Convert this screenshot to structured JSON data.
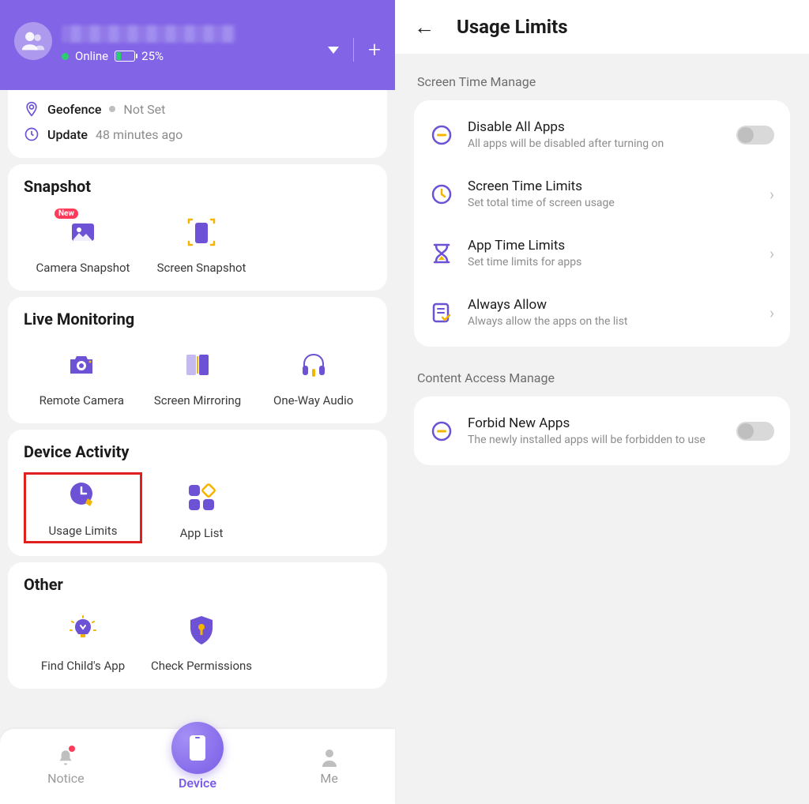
{
  "left": {
    "status_online": "Online",
    "battery": "25%",
    "geofence_label": "Geofence",
    "geofence_status": "Not Set",
    "update_label": "Update",
    "update_value": "48 minutes ago",
    "snapshot": {
      "title": "Snapshot",
      "camera": "Camera Snapshot",
      "screen": "Screen Snapshot",
      "new_badge": "New"
    },
    "live": {
      "title": "Live Monitoring",
      "remote_camera": "Remote Camera",
      "screen_mirroring": "Screen Mirroring",
      "one_way_audio": "One-Way Audio"
    },
    "activity": {
      "title": "Device Activity",
      "usage_limits": "Usage Limits",
      "app_list": "App List"
    },
    "other": {
      "title": "Other",
      "find_child": "Find Child's App",
      "check_permissions": "Check Permissions"
    },
    "nav": {
      "notice": "Notice",
      "device": "Device",
      "me": "Me"
    }
  },
  "right": {
    "title": "Usage Limits",
    "section1": "Screen Time Manage",
    "section2": "Content Access Manage",
    "disable_all": {
      "title": "Disable All Apps",
      "sub": "All apps will be disabled after turning on"
    },
    "screen_time": {
      "title": "Screen Time Limits",
      "sub": "Set total time of screen usage"
    },
    "app_time": {
      "title": "App Time Limits",
      "sub": "Set time limits for apps"
    },
    "always_allow": {
      "title": "Always Allow",
      "sub": "Always allow the apps on the list"
    },
    "forbid_new": {
      "title": "Forbid New Apps",
      "sub": "The newly installed apps will be forbidden to use"
    }
  }
}
